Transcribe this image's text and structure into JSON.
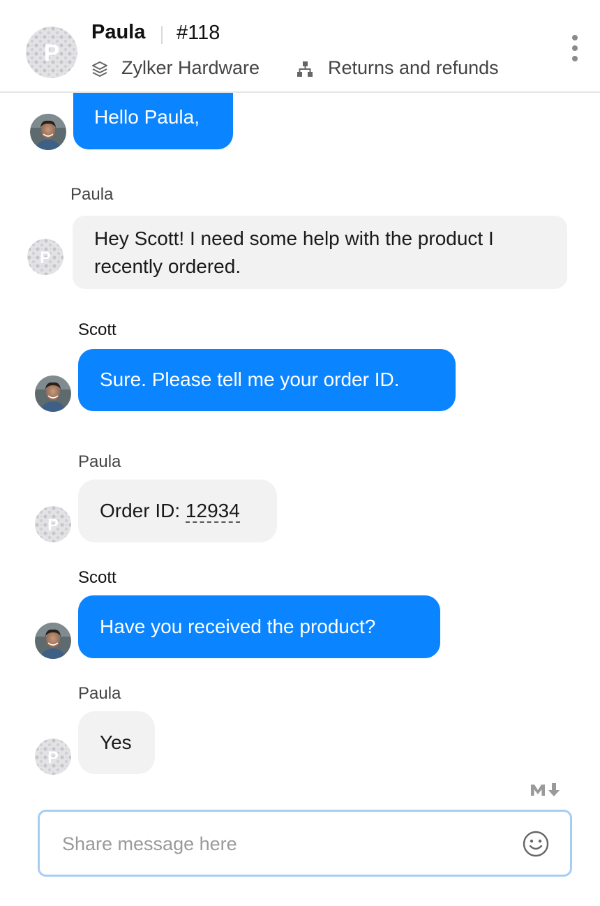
{
  "header": {
    "name": "Paula",
    "ticket": "#118",
    "department": "Zylker Hardware",
    "category": "Returns and refunds"
  },
  "messages": [
    {
      "sender": "",
      "role": "agent",
      "text": "Hello Paula,"
    },
    {
      "sender": "Paula",
      "role": "customer",
      "text": "Hey Scott! I need some help with the product I recently ordered."
    },
    {
      "sender": "Scott",
      "role": "agent",
      "text": "Sure. Please tell me your order ID."
    },
    {
      "sender": "Paula",
      "role": "customer",
      "text_prefix": "Order ID: ",
      "order_id": "12934"
    },
    {
      "sender": "Scott",
      "role": "agent",
      "text": "Have you received the product?"
    },
    {
      "sender": "Paula",
      "role": "customer",
      "text": "Yes"
    }
  ],
  "composer": {
    "placeholder": "Share message here",
    "markdown_icon": "markdown-icon",
    "emoji_icon": "smiley-icon"
  },
  "colors": {
    "agent_bubble": "#0a84ff",
    "customer_bubble": "#f2f2f2",
    "composer_border": "#a8cdf5"
  }
}
